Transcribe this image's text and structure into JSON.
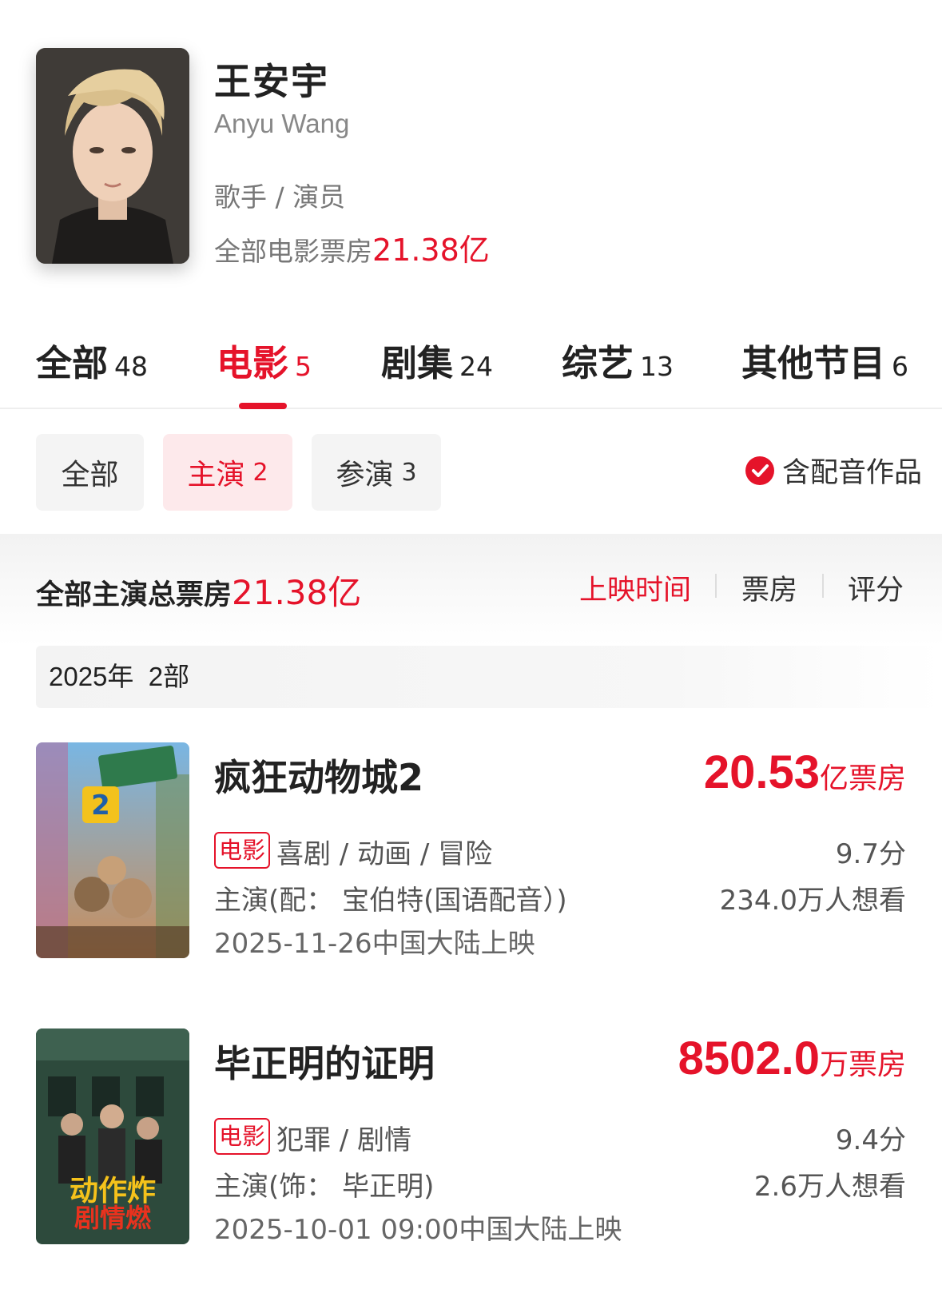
{
  "profile": {
    "name": "王安宇",
    "name_en": "Anyu Wang",
    "roles": "歌手 / 演员",
    "total_label": "全部电影票房",
    "total_value": "21.38亿"
  },
  "tabs": [
    {
      "label": "全部",
      "count": "48"
    },
    {
      "label": "电影",
      "count": "5"
    },
    {
      "label": "剧集",
      "count": "24"
    },
    {
      "label": "综艺",
      "count": "13"
    },
    {
      "label": "其他节目",
      "count": "6"
    }
  ],
  "filters": [
    {
      "label": "全部",
      "count": ""
    },
    {
      "label": "主演",
      "count": "2"
    },
    {
      "label": "参演",
      "count": "3"
    }
  ],
  "dub_toggle": {
    "label": "含配音作品",
    "checked": true
  },
  "summary": {
    "label": "全部主演总票房",
    "value": "21.38亿",
    "sorts": [
      "上映时间",
      "票房",
      "评分"
    ]
  },
  "year_group": {
    "year": "2025年",
    "count": "2部"
  },
  "movies": [
    {
      "title": "疯狂动物城2",
      "box_value": "20.53",
      "box_unit": "亿票房",
      "tag": "电影",
      "genres": "喜剧 / 动画 / 冒险",
      "role": "主演(配：  宝伯特(国语配音）)",
      "release": "2025-11-26中国大陆上映",
      "score": "9.7分",
      "want": "234.0万人想看"
    },
    {
      "title": "毕正明的证明",
      "box_value": "8502.0",
      "box_unit": "万票房",
      "tag": "电影",
      "genres": "犯罪 / 剧情",
      "role": "主演(饰：  毕正明)",
      "release": "2025-10-01 09:00中国大陆上映",
      "score": "9.4分",
      "want": "2.6万人想看"
    }
  ],
  "colors": {
    "accent": "#e5132a",
    "chip_active_bg": "#fde9eb"
  }
}
